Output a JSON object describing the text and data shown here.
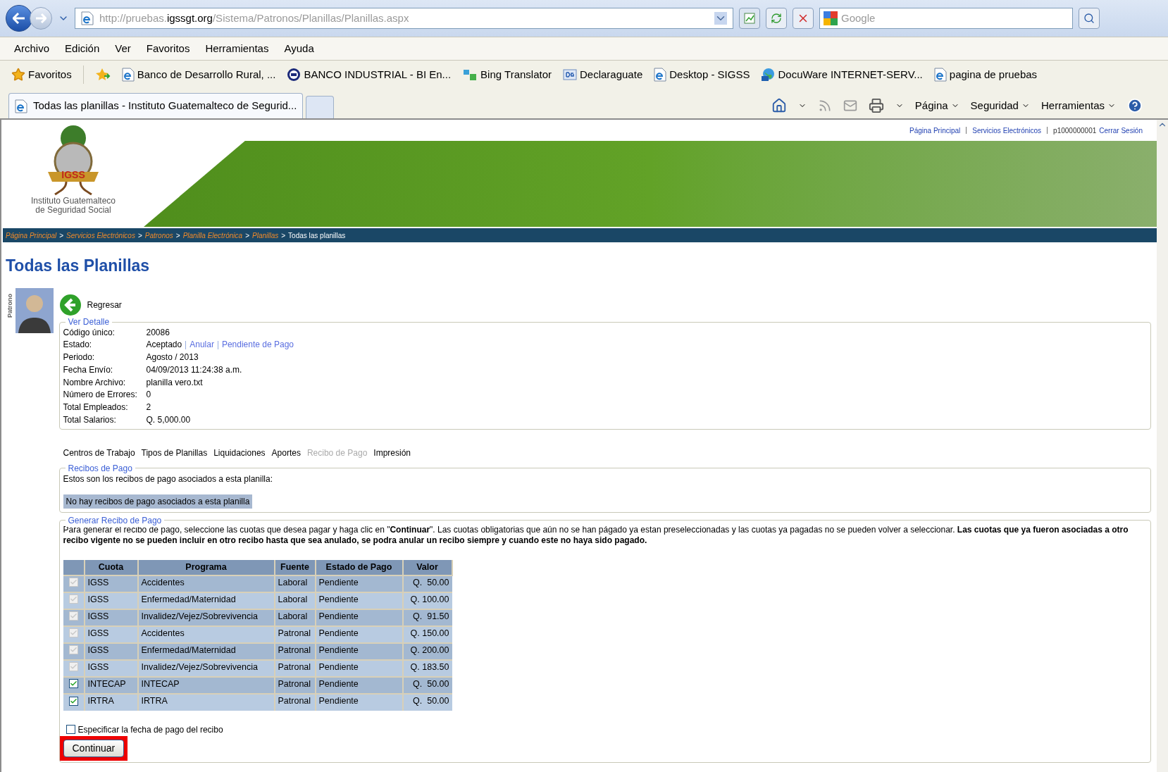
{
  "browser": {
    "url_prefix": "http://pruebas.",
    "url_host": "igssgt.org",
    "url_path": "/Sistema/Patronos/Planillas/Planillas.aspx",
    "search_placeholder": "Google",
    "menu": [
      "Archivo",
      "Edición",
      "Ver",
      "Favoritos",
      "Herramientas",
      "Ayuda"
    ],
    "favorites_label": "Favoritos",
    "bookmarks": [
      {
        "label": "Banco de Desarrollo Rural, ...",
        "kind": "page"
      },
      {
        "label": "BANCO INDUSTRIAL - BI En...",
        "kind": "bank"
      },
      {
        "label": "Bing Translator",
        "kind": "translate"
      },
      {
        "label": "Declaraguate",
        "kind": "dg"
      },
      {
        "label": "Desktop - SIGSS",
        "kind": "page"
      },
      {
        "label": "DocuWare INTERNET-SERV...",
        "kind": "globe"
      },
      {
        "label": "pagina de pruebas",
        "kind": "page"
      }
    ],
    "tab_title": "Todas las planillas - Instituto Guatemalteco de Segurid...",
    "tools": [
      "Página",
      "Seguridad",
      "Herramientas"
    ]
  },
  "page": {
    "top_links": [
      "Página Principal",
      "Servicios Electrónicos"
    ],
    "user": "p1000000001",
    "logout": "Cerrar Sesión",
    "logo_badge": "IGSS",
    "logo_lines": [
      "Instituto Guatemalteco",
      "de Seguridad Social"
    ],
    "breadcrumb": [
      {
        "label": "Página Principal",
        "current": false
      },
      {
        "label": "Servicios Electrónicos",
        "current": false,
        "separator": ">"
      },
      {
        "label": "Patronos",
        "current": false,
        "separator": ">"
      },
      {
        "label": "Planilla Electrónica",
        "current": false,
        "separator": ">"
      },
      {
        "label": "Planillas",
        "current": false,
        "separator": ">"
      },
      {
        "label": "Todas las planillas",
        "current": true,
        "separator": ">"
      }
    ],
    "title": "Todas las Planillas",
    "side_label": "Patrono",
    "back": "Regresar",
    "detail": {
      "legend": "Ver Detalle",
      "fields": [
        {
          "label": "Código único:",
          "value": "20086"
        },
        {
          "label": "Estado:",
          "value": "Aceptado",
          "links": [
            "Anular",
            "Pendiente de Pago"
          ]
        },
        {
          "label": "Periodo:",
          "value": "Agosto / 2013"
        },
        {
          "label": "Fecha Envío:",
          "value": "04/09/2013 11:24:38 a.m."
        },
        {
          "label": "Nombre Archivo:",
          "value": "planilla vero.txt"
        },
        {
          "label": "Número de Errores:",
          "value": "0"
        },
        {
          "label": "Total Empleados:",
          "value": "2"
        },
        {
          "label": "Total Salarios:",
          "value": "Q. 5,000.00"
        }
      ]
    },
    "tabs": [
      {
        "label": "Centros de Trabajo",
        "selected": false
      },
      {
        "label": "Tipos de Planillas",
        "selected": false
      },
      {
        "label": "Liquidaciones",
        "selected": false
      },
      {
        "label": "Aportes",
        "selected": false
      },
      {
        "label": "Recibo de Pago",
        "selected": true
      },
      {
        "label": "Impresión",
        "selected": false
      }
    ],
    "receipts": {
      "legend": "Recibos de Pago",
      "text": "Estos son los recibos de pago asociados a esta planilla:",
      "empty": "No hay recibos de pago asociados a esta planilla"
    },
    "generate": {
      "legend": "Generar Recibo de Pago",
      "intro": "Para generar el recibo de pago, seleccione las cuotas que desea pagar y haga clic en \"**Continuar**\". Las cuotas obligatorias que aún no se han págado ya estan preseleccionadas y las cuotas ya pagadas no se pueden volver a seleccionar. **Las cuotas que ya fueron asociadas a otro recibo vigente no se pueden incluir en otro recibo hasta que sea anulado, se podra anular un recibo siempre y cuando este no haya sido pagado.**",
      "columns": [
        "Cuota",
        "Programa",
        "Fuente",
        "Estado de Pago",
        "Valor"
      ],
      "rows": [
        {
          "checked": true,
          "disabled": true,
          "cuota": "IGSS",
          "programa": "Accidentes",
          "fuente": "Laboral",
          "estado": "Pendiente",
          "valor": "Q.  50.00"
        },
        {
          "checked": true,
          "disabled": true,
          "cuota": "IGSS",
          "programa": "Enfermedad/Maternidad",
          "fuente": "Laboral",
          "estado": "Pendiente",
          "valor": "Q. 100.00"
        },
        {
          "checked": true,
          "disabled": true,
          "cuota": "IGSS",
          "programa": "Invalidez/Vejez/Sobrevivencia",
          "fuente": "Laboral",
          "estado": "Pendiente",
          "valor": "Q.  91.50"
        },
        {
          "checked": true,
          "disabled": true,
          "cuota": "IGSS",
          "programa": "Accidentes",
          "fuente": "Patronal",
          "estado": "Pendiente",
          "valor": "Q. 150.00"
        },
        {
          "checked": true,
          "disabled": true,
          "cuota": "IGSS",
          "programa": "Enfermedad/Maternidad",
          "fuente": "Patronal",
          "estado": "Pendiente",
          "valor": "Q. 200.00"
        },
        {
          "checked": true,
          "disabled": true,
          "cuota": "IGSS",
          "programa": "Invalidez/Vejez/Sobrevivencia",
          "fuente": "Patronal",
          "estado": "Pendiente",
          "valor": "Q. 183.50"
        },
        {
          "checked": true,
          "disabled": false,
          "cuota": "INTECAP",
          "programa": "INTECAP",
          "fuente": "Patronal",
          "estado": "Pendiente",
          "valor": "Q.  50.00"
        },
        {
          "checked": true,
          "disabled": false,
          "cuota": "IRTRA",
          "programa": "IRTRA",
          "fuente": "Patronal",
          "estado": "Pendiente",
          "valor": "Q.  50.00"
        }
      ],
      "date_option": {
        "label": "Especificar la fecha de pago del recibo",
        "checked": false
      },
      "button": {
        "label": "Continuar",
        "highlighted": true
      }
    }
  }
}
